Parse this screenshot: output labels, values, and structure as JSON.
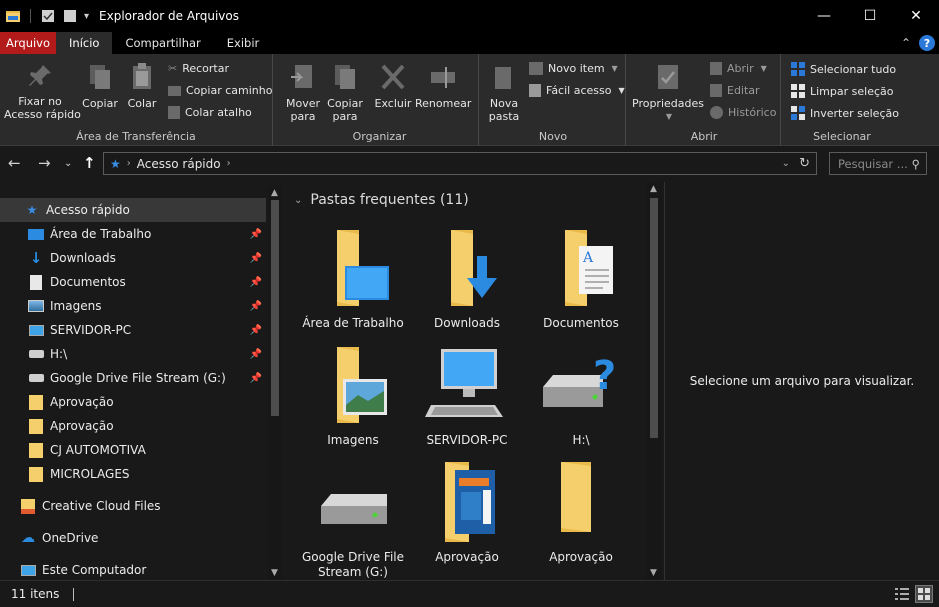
{
  "window": {
    "title": "Explorador de Arquivos",
    "controls": {
      "minimize": "—",
      "maximize": "☐",
      "close": "✕"
    }
  },
  "ribbon_tabs": [
    "Arquivo",
    "Início",
    "Compartilhar",
    "Exibir"
  ],
  "ribbon": {
    "clipboard": {
      "label": "Área de Transferência",
      "pin": "Fixar no\nAcesso rápido",
      "copy": "Copiar",
      "paste": "Colar",
      "cut": "Recortar",
      "copy_path": "Copiar caminho",
      "paste_shortcut": "Colar atalho"
    },
    "organize": {
      "label": "Organizar",
      "move": "Mover\npara",
      "copy_to": "Copiar\npara",
      "delete": "Excluir",
      "rename": "Renomear"
    },
    "new": {
      "label": "Novo",
      "new_folder": "Nova\npasta",
      "new_item": "Novo item",
      "easy_access": "Fácil acesso"
    },
    "open": {
      "label": "Abrir",
      "properties": "Propriedades",
      "open": "Abrir",
      "edit": "Editar",
      "history": "Histórico"
    },
    "select": {
      "label": "Selecionar",
      "select_all": "Selecionar tudo",
      "select_none": "Limpar seleção",
      "invert": "Inverter seleção"
    }
  },
  "address": {
    "path": "Acesso rápido",
    "search_placeholder": "Pesquisar ..."
  },
  "sidebar": {
    "items": [
      {
        "label": "Acesso rápido",
        "icon": "star-icon"
      },
      {
        "label": "Área de Trabalho",
        "icon": "desktop-icon",
        "pinned": true
      },
      {
        "label": "Downloads",
        "icon": "download-icon",
        "pinned": true
      },
      {
        "label": "Documentos",
        "icon": "document-icon",
        "pinned": true
      },
      {
        "label": "Imagens",
        "icon": "image-icon",
        "pinned": true
      },
      {
        "label": "SERVIDOR-PC",
        "icon": "computer-icon",
        "pinned": true
      },
      {
        "label": "H:\\",
        "icon": "drive-icon",
        "pinned": true
      },
      {
        "label": "Google Drive File Stream (G:)",
        "icon": "drive-icon",
        "pinned": true
      },
      {
        "label": "Aprovação",
        "icon": "folder-icon"
      },
      {
        "label": "Aprovação",
        "icon": "folder-icon"
      },
      {
        "label": "CJ AUTOMOTIVA",
        "icon": "folder-icon"
      },
      {
        "label": "MICROLAGES",
        "icon": "folder-icon"
      },
      {
        "label": "Creative Cloud Files",
        "icon": "creative-cloud-icon"
      },
      {
        "label": "OneDrive",
        "icon": "cloud-icon"
      },
      {
        "label": "Este Computador",
        "icon": "computer-icon"
      }
    ]
  },
  "content": {
    "group_title": "Pastas frequentes (11)",
    "tiles": [
      {
        "label": "Área de Trabalho",
        "icon": "desktop-folder-icon"
      },
      {
        "label": "Downloads",
        "icon": "downloads-folder-icon"
      },
      {
        "label": "Documentos",
        "icon": "documents-folder-icon"
      },
      {
        "label": "Imagens",
        "icon": "pictures-folder-icon"
      },
      {
        "label": "SERVIDOR-PC",
        "icon": "network-computer-icon"
      },
      {
        "label": "H:\\",
        "icon": "unknown-drive-icon"
      },
      {
        "label": "Google Drive File Stream (G:)",
        "icon": "hard-drive-icon"
      },
      {
        "label": "Aprovação",
        "icon": "folder-with-document-icon"
      },
      {
        "label": "Aprovação",
        "icon": "folder-icon"
      }
    ]
  },
  "preview": {
    "text": "Selecione um arquivo para visualizar."
  },
  "status": {
    "count": "11 itens"
  },
  "colors": {
    "accent": "#2a79d8",
    "file_tab": "#b31b1b",
    "folder": "#f5cf6c"
  }
}
